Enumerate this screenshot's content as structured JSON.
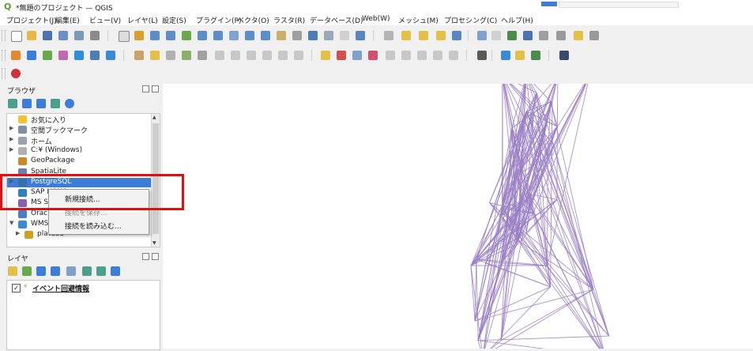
{
  "window": {
    "title": "*無題のプロジェクト — QGIS"
  },
  "menubar": {
    "items": [
      "プロジェクト(J)",
      "編集(E)",
      "ビュー(V)",
      "レイヤ(L)",
      "設定(S)",
      "プラグイン(P)",
      "ベクタ(O)",
      "ラスタ(R)",
      "データベース(D)",
      "Web(W)",
      "メッシュ(M)",
      "プロセシング(C)",
      "ヘルプ(H)"
    ]
  },
  "browser_panel": {
    "title": "ブラウザ",
    "items": [
      {
        "label": "お気に入り",
        "icon": "star-icon",
        "color": "#f2c230"
      },
      {
        "label": "空間ブックマーク",
        "icon": "bookmark-icon",
        "color": "#7f8fa6"
      },
      {
        "label": "ホーム",
        "icon": "home-icon",
        "color": "#9aa3ad"
      },
      {
        "label": "C:¥ (Windows)",
        "icon": "drive-icon",
        "color": "#b0b0b0"
      },
      {
        "label": "GeoPackage",
        "icon": "geopackage-icon",
        "color": "#c98a2b"
      },
      {
        "label": "SpatiaLite",
        "icon": "spatialite-icon",
        "color": "#6a7fb5"
      },
      {
        "label": "PostgreSQL",
        "icon": "postgresql-icon",
        "color": "#3a6ea8"
      },
      {
        "label": "SAP HANA",
        "icon": "sap-hana-icon",
        "color": "#2f7fc1"
      },
      {
        "label": "MS SQL Server",
        "icon": "mssql-icon",
        "color": "#8a5fb0"
      },
      {
        "label": "Oracle",
        "icon": "oracle-icon",
        "color": "#4c7bc8"
      },
      {
        "label": "WMS/WMTS",
        "icon": "wms-icon",
        "color": "#3c8ad6"
      },
      {
        "label": "plateau",
        "icon": "layer-icon",
        "color": "#d0a020"
      }
    ]
  },
  "context_menu": {
    "items": [
      {
        "label": "新規接続...",
        "enabled": true
      },
      {
        "label": "接続を保存...",
        "enabled": false
      },
      {
        "label": "接続を読み込む...",
        "enabled": true
      }
    ]
  },
  "layers_panel": {
    "title": "レイヤ",
    "layers": [
      {
        "label": "イベント回避情報",
        "checked": true
      }
    ]
  },
  "colors": {
    "accent": "#3b7dd8",
    "highlight": "#e01010",
    "network": "#9a7fc4"
  }
}
